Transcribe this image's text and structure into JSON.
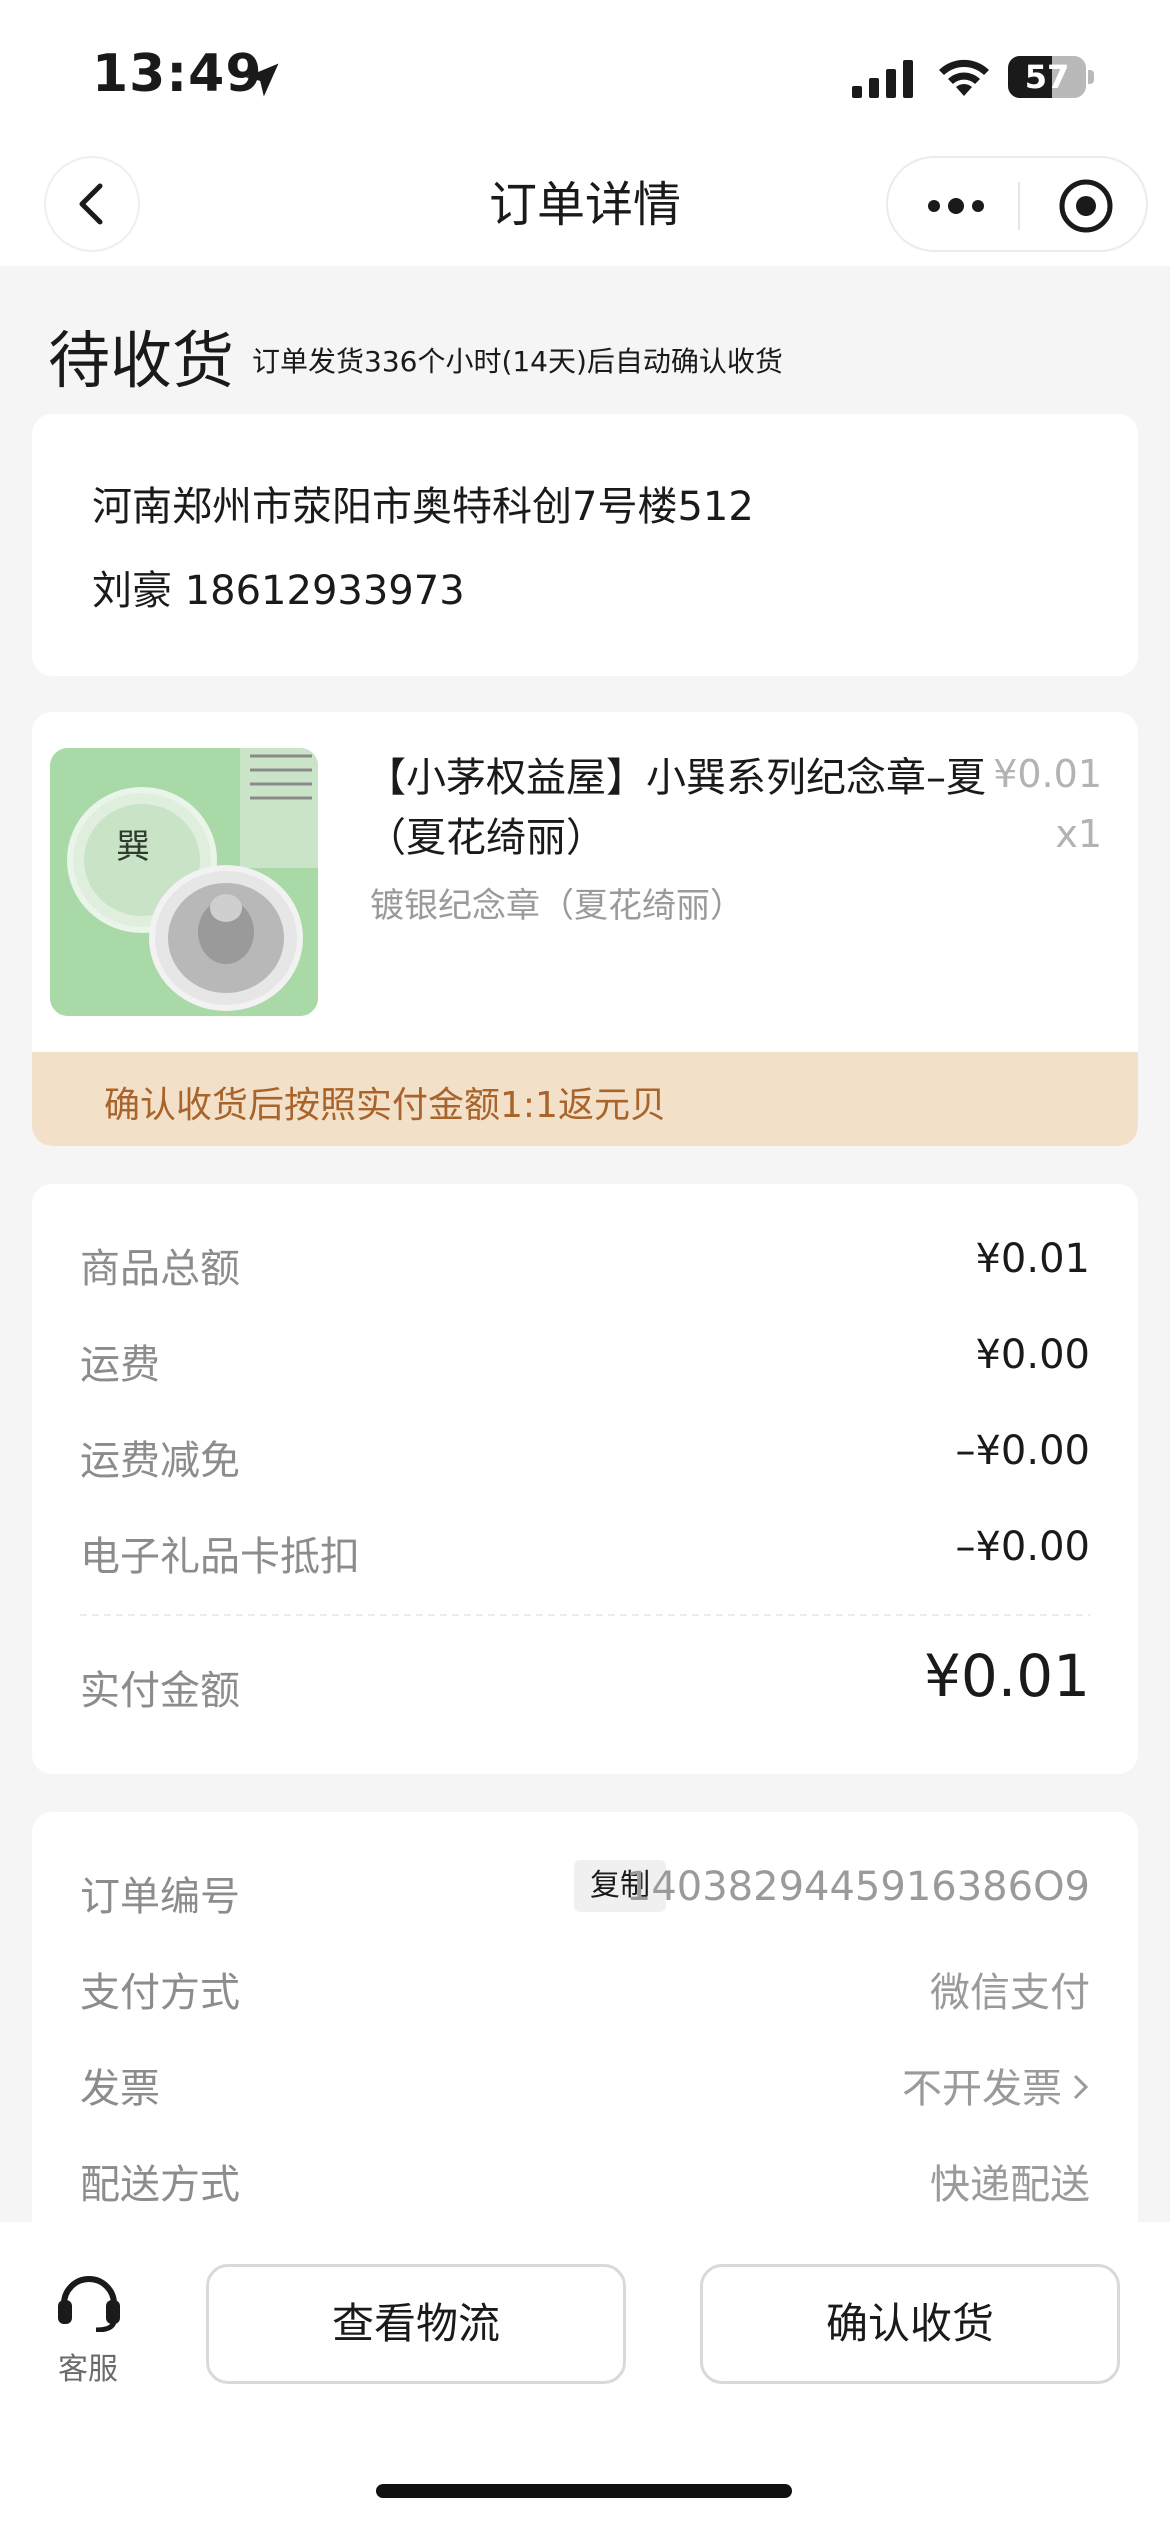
{
  "status_bar": {
    "time": "13:49",
    "battery_level": "57",
    "battery_percent": 57
  },
  "nav": {
    "title": "订单详情"
  },
  "order": {
    "status": "待收货",
    "status_desc": "订单发货336个小时(14天)后自动确认收货"
  },
  "address": {
    "line": "河南郑州市荥阳市奥特科创7号楼512",
    "contact": "刘豪 18612933973"
  },
  "product": {
    "name": "【小茅权益屋】小巽系列纪念章–夏（夏花绮丽）",
    "spec": "镀银纪念章（夏花绮丽）",
    "price": "¥0.01",
    "quantity": "x1",
    "rebate_notice": "确认收货后按照实付金额1:1返元贝",
    "image_background": "#a9d9a6"
  },
  "amounts": {
    "rows": [
      {
        "label": "商品总额",
        "value": "¥0.01"
      },
      {
        "label": "运费",
        "value": "¥0.00"
      },
      {
        "label": "运费减免",
        "value": "–¥0.00"
      },
      {
        "label": "电子礼品卡抵扣",
        "value": "–¥0.00"
      }
    ],
    "total_label": "实付金额",
    "total_value": "¥0.01"
  },
  "info": {
    "order_no_label": "订单编号",
    "copy_label": "复制",
    "order_no": "1403829445916386O9",
    "pay_label": "支付方式",
    "pay_value": "微信支付",
    "invoice_label": "发票",
    "invoice_value": "不开发票",
    "delivery_label": "配送方式",
    "delivery_value": "快递配送"
  },
  "bottom": {
    "service_label": "客服",
    "logistics_label": "查看物流",
    "confirm_label": "确认收货"
  },
  "colors": {
    "accent_banner": "#f3e0c9",
    "accent_text": "#a8642a",
    "background": "#f5f5f5"
  }
}
